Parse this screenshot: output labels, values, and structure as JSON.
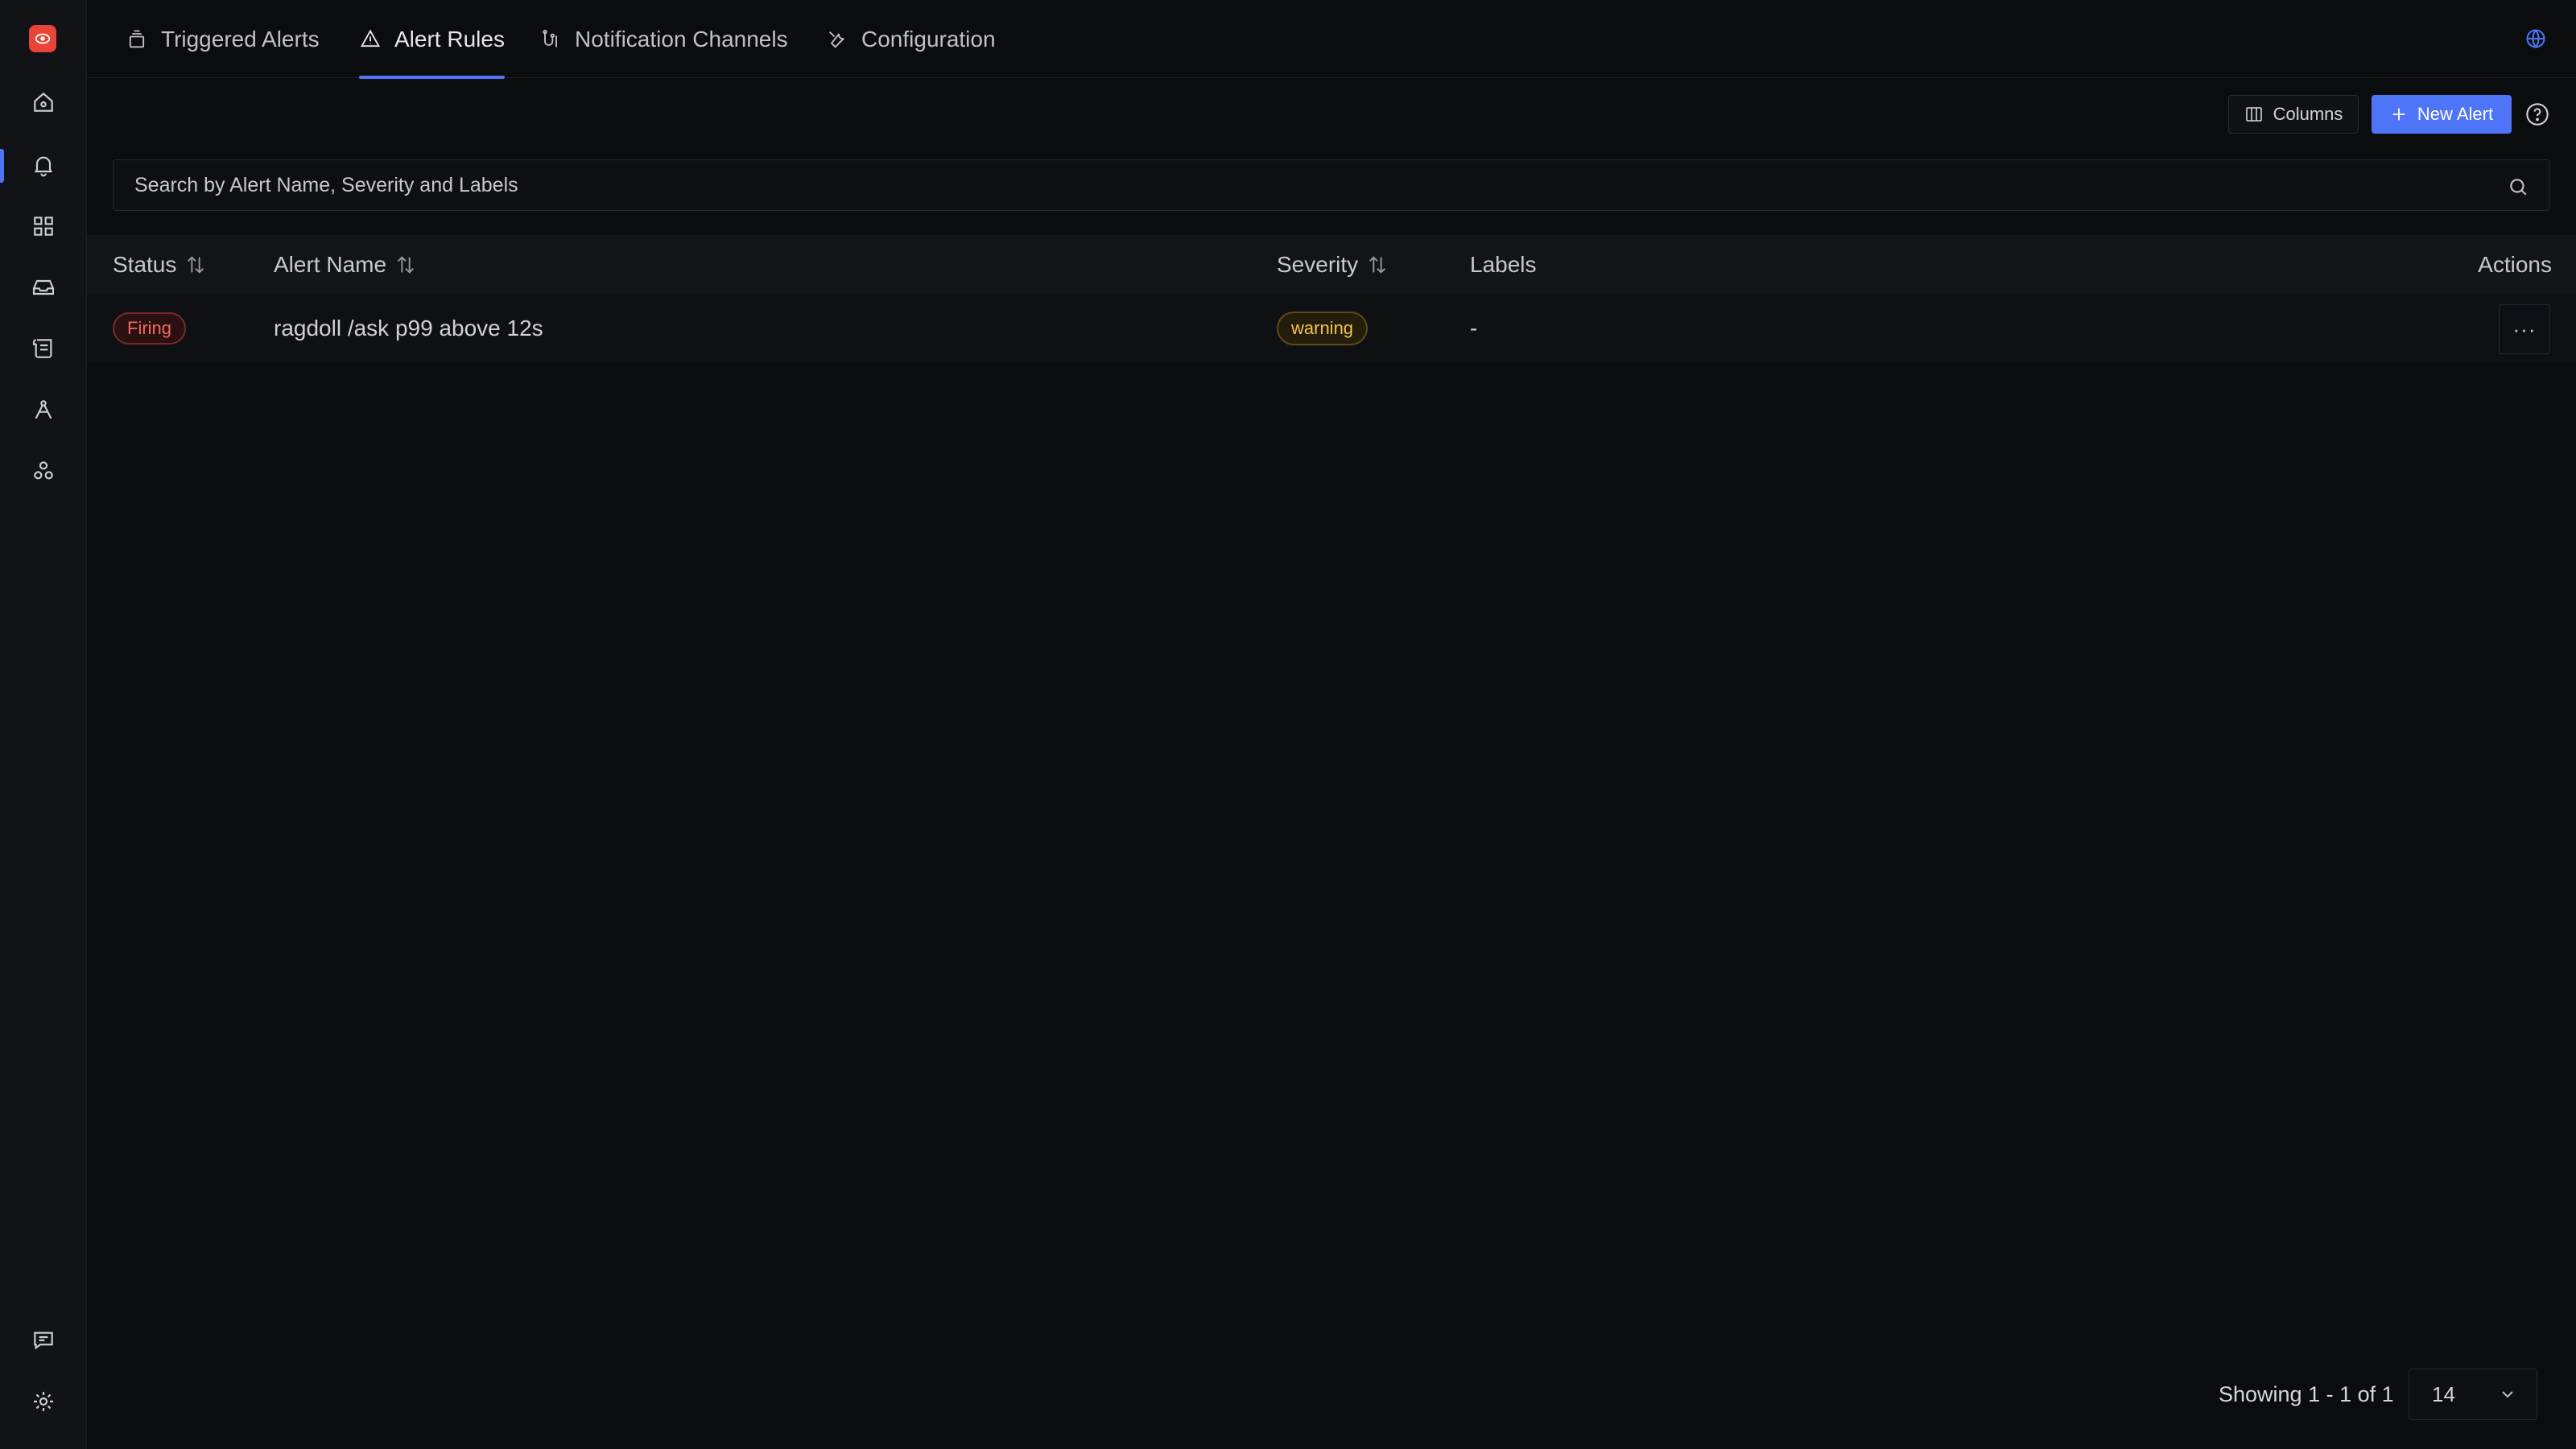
{
  "sidebar": {
    "logo_icon": "eye-logo",
    "items": [
      {
        "icon": "home-icon"
      },
      {
        "icon": "alert-bell-icon",
        "active": true
      },
      {
        "icon": "grid-icon"
      },
      {
        "icon": "inbox-icon"
      },
      {
        "icon": "logs-icon"
      },
      {
        "icon": "traces-icon"
      },
      {
        "icon": "integrations-icon"
      }
    ],
    "bottom_items": [
      {
        "icon": "chat-icon"
      },
      {
        "icon": "settings-icon"
      }
    ]
  },
  "tabs": [
    {
      "label": "Triggered Alerts",
      "icon": "stack-icon"
    },
    {
      "label": "Alert Rules",
      "icon": "warning-triangle-icon",
      "active": true
    },
    {
      "label": "Notification Channels",
      "icon": "channels-icon"
    },
    {
      "label": "Configuration",
      "icon": "tools-icon"
    }
  ],
  "toolbar": {
    "columns_label": "Columns",
    "new_alert_label": "New Alert"
  },
  "search": {
    "placeholder": "Search by Alert Name, Severity and Labels",
    "value": ""
  },
  "table": {
    "headers": {
      "status": "Status",
      "alert_name": "Alert Name",
      "severity": "Severity",
      "labels": "Labels",
      "actions": "Actions"
    },
    "rows": [
      {
        "status": "Firing",
        "alert_name": "ragdoll /ask p99 above 12s",
        "severity": "warning",
        "labels": "-",
        "actions": "···"
      }
    ]
  },
  "footer": {
    "showing_text": "Showing 1 - 1 of 1",
    "page_size": "14"
  },
  "colors": {
    "accent": "#4e74f8",
    "background": "#0b0c0e",
    "firing": "#f06a64",
    "warning": "#f4c34a"
  }
}
